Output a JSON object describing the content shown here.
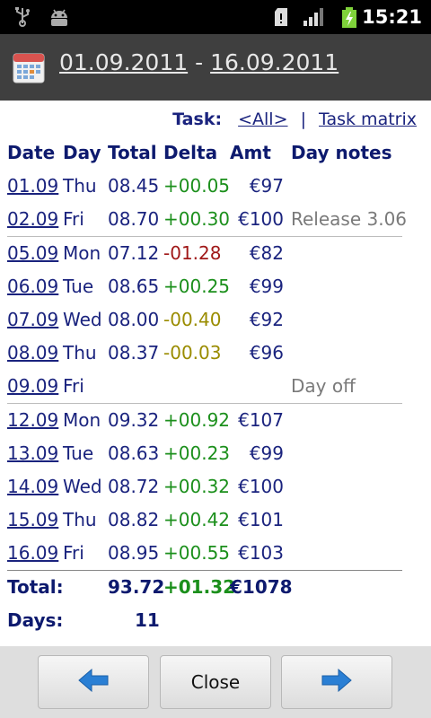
{
  "status_bar": {
    "time": "15:21",
    "icons": [
      "usb-icon",
      "android-debug-icon",
      "sd-card-icon",
      "signal-icon",
      "battery-charging-icon"
    ]
  },
  "header": {
    "date_from": "01.09.2011",
    "separator": "-",
    "date_to": "16.09.2011",
    "icon": "calendar-icon"
  },
  "task_filter": {
    "label": "Task:",
    "all_link": "<All>",
    "divider": "|",
    "matrix_link": "Task matrix"
  },
  "table": {
    "columns": [
      "Date",
      "Day",
      "Total",
      "Delta",
      "Amt",
      "Day notes"
    ],
    "rows": [
      {
        "date": "01.09",
        "day": "Thu",
        "total": "08.45",
        "delta": "+00.05",
        "delta_type": "pos",
        "amt": "€97",
        "note": ""
      },
      {
        "date": "02.09",
        "day": "Fri",
        "total": "08.70",
        "delta": "+00.30",
        "delta_type": "pos",
        "amt": "€100",
        "note": "Release 3.06"
      },
      {
        "date": "05.09",
        "day": "Mon",
        "total": "07.12",
        "delta": "-01.28",
        "delta_type": "neg",
        "amt": "€82",
        "note": ""
      },
      {
        "date": "06.09",
        "day": "Tue",
        "total": "08.65",
        "delta": "+00.25",
        "delta_type": "pos",
        "amt": "€99",
        "note": ""
      },
      {
        "date": "07.09",
        "day": "Wed",
        "total": "08.00",
        "delta": "-00.40",
        "delta_type": "warn",
        "amt": "€92",
        "note": ""
      },
      {
        "date": "08.09",
        "day": "Thu",
        "total": "08.37",
        "delta": "-00.03",
        "delta_type": "warn",
        "amt": "€96",
        "note": ""
      },
      {
        "date": "09.09",
        "day": "Fri",
        "total": "",
        "delta": "",
        "delta_type": "pos",
        "amt": "",
        "note": "Day off"
      },
      {
        "date": "12.09",
        "day": "Mon",
        "total": "09.32",
        "delta": "+00.92",
        "delta_type": "pos",
        "amt": "€107",
        "note": ""
      },
      {
        "date": "13.09",
        "day": "Tue",
        "total": "08.63",
        "delta": "+00.23",
        "delta_type": "pos",
        "amt": "€99",
        "note": ""
      },
      {
        "date": "14.09",
        "day": "Wed",
        "total": "08.72",
        "delta": "+00.32",
        "delta_type": "pos",
        "amt": "€100",
        "note": ""
      },
      {
        "date": "15.09",
        "day": "Thu",
        "total": "08.82",
        "delta": "+00.42",
        "delta_type": "pos",
        "amt": "€101",
        "note": ""
      },
      {
        "date": "16.09",
        "day": "Fri",
        "total": "08.95",
        "delta": "+00.55",
        "delta_type": "pos",
        "amt": "€103",
        "note": ""
      }
    ],
    "totals": {
      "label": "Total:",
      "total": "93.72",
      "delta": "+01.32",
      "amt": "€1078"
    },
    "days": {
      "label": "Days:",
      "value": "11"
    }
  },
  "buttons": {
    "prev_icon": "arrow-left-icon",
    "close_label": "Close",
    "next_icon": "arrow-right-icon"
  },
  "colors": {
    "link": "#1a237e",
    "positive": "#1b8f1b",
    "negative": "#a01818",
    "warning": "#9a8c00",
    "note": "#7a7a7a",
    "arrow": "#2a7fd4"
  }
}
